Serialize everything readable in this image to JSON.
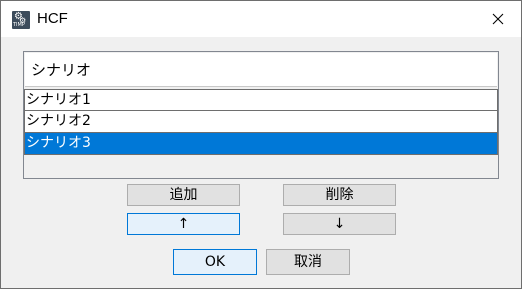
{
  "window": {
    "title": "HCF",
    "app_icon_text": "TIMP",
    "close_icon": "close-icon"
  },
  "list": {
    "header": "シナリオ",
    "items": [
      "シナリオ1",
      "シナリオ2",
      "シナリオ3"
    ],
    "selected_index": 2
  },
  "buttons": {
    "add": "追加",
    "delete": "削除",
    "up": "↑",
    "down": "↓",
    "ok": "OK",
    "cancel": "取消"
  },
  "colors": {
    "selection": "#0078d7",
    "focus_border": "#0078d7",
    "button_face": "#e1e1e1"
  }
}
